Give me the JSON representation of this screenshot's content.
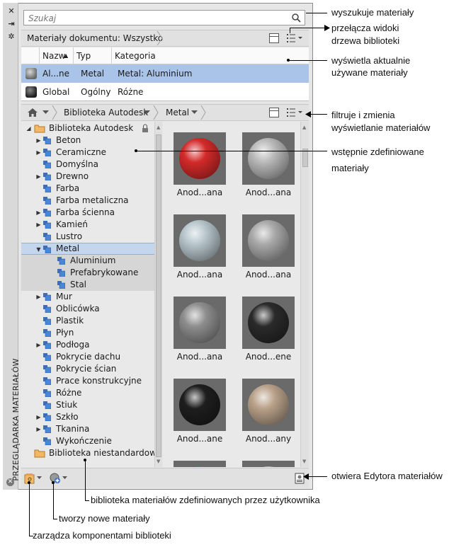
{
  "palette": {
    "vertical_title": "PRZEGLĄDARKA MATERIAŁÓW",
    "strip_buttons": [
      "close-icon",
      "autohide-icon",
      "properties-icon"
    ]
  },
  "search": {
    "placeholder": "Szukaj"
  },
  "document_bar": {
    "label": "Materiały dokumentu: Wszystko"
  },
  "document_table": {
    "columns": [
      "Nazw",
      "Typ",
      "Kategoria"
    ],
    "sort_indicator": "▲",
    "rows": [
      {
        "name": "Al...ne",
        "type": "Metal",
        "category": "Metal: Aluminium",
        "selected": true
      },
      {
        "name": "Global",
        "type": "Ogólny",
        "category": "Różne",
        "selected": false
      }
    ]
  },
  "library_bar": {
    "breadcrumbs": [
      "Biblioteka Autodesk",
      "Metal"
    ]
  },
  "tree": {
    "root": "Biblioteka Autodesk",
    "items": [
      {
        "label": "Beton",
        "expandable": true
      },
      {
        "label": "Ceramiczne",
        "expandable": true
      },
      {
        "label": "Domyślna",
        "expandable": false
      },
      {
        "label": "Drewno",
        "expandable": true
      },
      {
        "label": "Farba",
        "expandable": false
      },
      {
        "label": "Farba metaliczna",
        "expandable": false
      },
      {
        "label": "Farba ścienna",
        "expandable": true
      },
      {
        "label": "Kamień",
        "expandable": true
      },
      {
        "label": "Lustro",
        "expandable": false
      },
      {
        "label": "Metal",
        "expandable": true,
        "expanded": true,
        "selected": true
      },
      {
        "label": "Aluminium",
        "child": true
      },
      {
        "label": "Prefabrykowane",
        "child": true
      },
      {
        "label": "Stal",
        "child": true
      },
      {
        "label": "Mur",
        "expandable": true
      },
      {
        "label": "Oblicówka",
        "expandable": false
      },
      {
        "label": "Plastik",
        "expandable": false
      },
      {
        "label": "Płyn",
        "expandable": false
      },
      {
        "label": "Podłoga",
        "expandable": true
      },
      {
        "label": "Pokrycie dachu",
        "expandable": false
      },
      {
        "label": "Pokrycie ścian",
        "expandable": false
      },
      {
        "label": "Prace konstrukcyjne",
        "expandable": false
      },
      {
        "label": "Różne",
        "expandable": false
      },
      {
        "label": "Stiuk",
        "expandable": false
      },
      {
        "label": "Szkło",
        "expandable": true
      },
      {
        "label": "Tkanina",
        "expandable": true
      },
      {
        "label": "Wykończenie",
        "expandable": false
      }
    ],
    "custom_library": "Biblioteka niestandardowa"
  },
  "materials": [
    {
      "label": "Anod...ana",
      "color": "#d42a2a"
    },
    {
      "label": "Anod...ana",
      "color": "#b9b9b9"
    },
    {
      "label": "Anod...ana",
      "color": "#b7c6cc"
    },
    {
      "label": "Anod...ana",
      "color": "#a9a9a9"
    },
    {
      "label": "Anod...ana",
      "color": "#8e8e8e"
    },
    {
      "label": "Anod...ene",
      "color": "#2a2a2a"
    },
    {
      "label": "Anod...ane",
      "color": "#1e1e1e"
    },
    {
      "label": "Anod...any",
      "color": "#b9a18a"
    }
  ],
  "annotations": {
    "search": "wyszukuje materiały",
    "toggle_tree_1": "przełącza widoki",
    "toggle_tree_2": "drzewa biblioteki",
    "current_1": "wyświetla aktualnie",
    "current_2": "używane materiały",
    "filter_1": "filtruje i zmienia",
    "filter_2": "wyświetlanie materiałów",
    "predefined_1": "wstępnie zdefiniowane",
    "predefined_2": "materiały",
    "editor": "otwiera Edytora materiałów",
    "user_lib": "biblioteka materiałów zdefiniowanych przez użytkownika",
    "create": "tworzy nowe materiały",
    "manage": "zarządza komponentami biblioteki"
  }
}
